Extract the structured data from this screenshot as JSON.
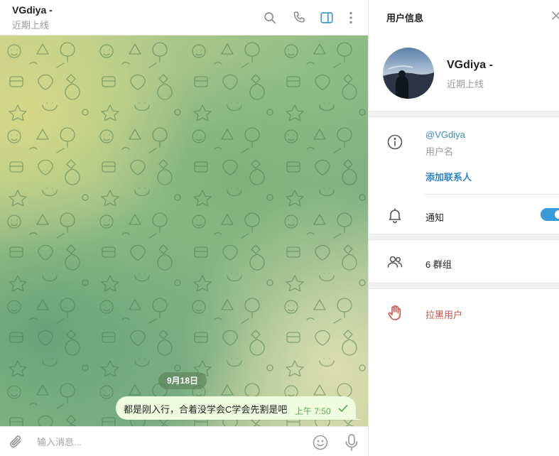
{
  "chat": {
    "header": {
      "name": "VGdiya -",
      "status": "近期上线",
      "icons": [
        "search-icon",
        "phone-icon",
        "sidebar-toggle-icon",
        "more-vertical-icon"
      ]
    },
    "date_separator": "9月18日",
    "messages": [
      {
        "text": "都是刚入行，合着没学会C学会先割是吧",
        "time": "上午 7:50",
        "status_icon": "check-icon",
        "outgoing": true
      }
    ],
    "composer": {
      "placeholder": "输入消息..."
    }
  },
  "info_panel": {
    "title": "用户信息",
    "name": "VGdiya -",
    "status": "近期上线",
    "username": "@VGdiya",
    "username_caption": "用户名",
    "add_contact": "添加联系人",
    "notifications_label": "通知",
    "notifications_on": true,
    "groups_label": "6 群组",
    "block_label": "拉黑用户"
  },
  "colors": {
    "accent": "#3a9ad9",
    "link": "#3a8ac9",
    "danger": "#d2504a",
    "bubble_out": "#effdde",
    "time_green": "#5ea857"
  }
}
